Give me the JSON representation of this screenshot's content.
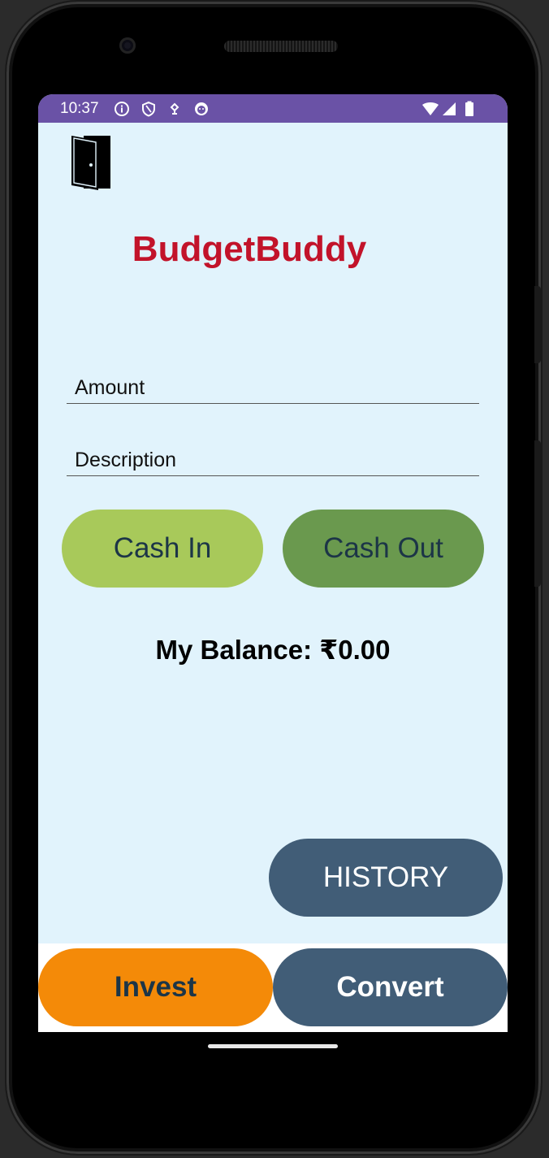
{
  "status_bar": {
    "time": "10:37",
    "left_icons": [
      "info-icon",
      "shield-icon",
      "location-icon",
      "smiley-icon"
    ],
    "right_icons": [
      "wifi-icon",
      "signal-icon",
      "battery-icon"
    ]
  },
  "app": {
    "title": "BudgetBuddy",
    "exit_icon": "door-exit-icon"
  },
  "form": {
    "amount_placeholder": "Amount",
    "amount_value": "",
    "description_placeholder": "Description",
    "description_value": ""
  },
  "buttons": {
    "cash_in": "Cash In",
    "cash_out": "Cash Out",
    "history": "HISTORY",
    "invest": "Invest",
    "convert": "Convert"
  },
  "balance": {
    "text": "My Balance: ₹0.00"
  },
  "colors": {
    "status_bar": "#6a52a6",
    "background": "#e1f3fc",
    "title": "#c2132a",
    "cash_in": "#a8c95a",
    "cash_out": "#6a994e",
    "history": "#415d77",
    "invest": "#f48a08",
    "convert": "#415d77"
  }
}
